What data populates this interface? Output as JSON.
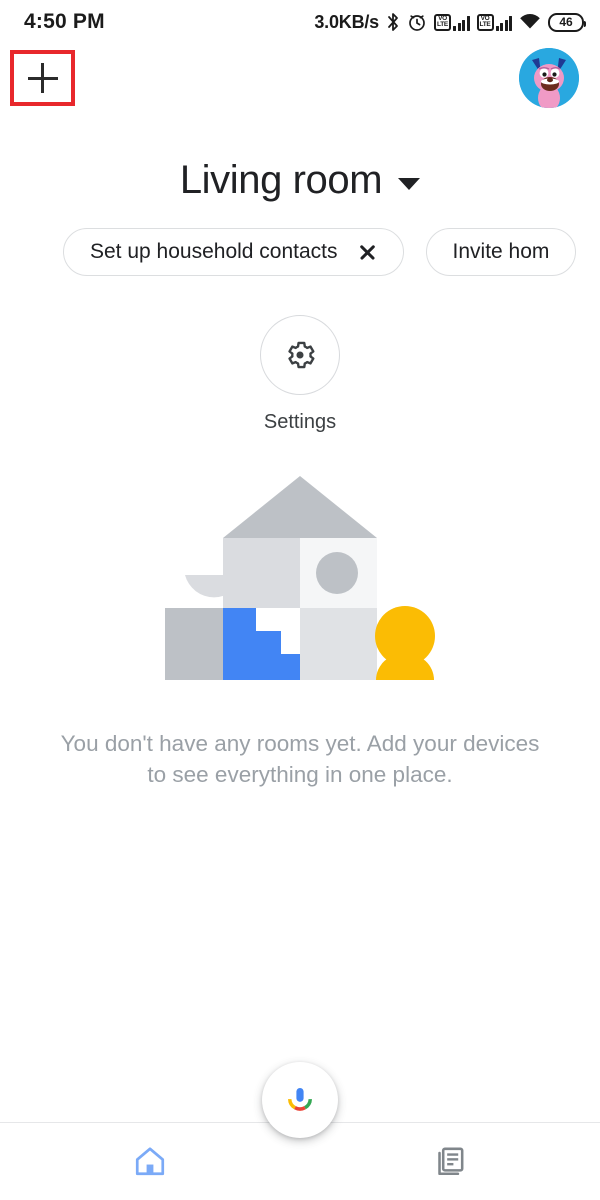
{
  "status_bar": {
    "time": "4:50 PM",
    "net_speed": "3.0KB/s",
    "bluetooth_icon": "bluetooth-icon",
    "alarm_icon": "alarm-clock-icon",
    "volte_label_top": "VO",
    "volte_label_bottom": "LTE",
    "sim1_icon": "volte-sim1-signal-icon",
    "sim2_icon": "volte-sim2-signal-icon",
    "wifi_icon": "wifi-icon",
    "battery_level": "46"
  },
  "top_bar": {
    "add_icon": "plus-icon",
    "add_label": "+",
    "avatar_icon": "account-avatar"
  },
  "home": {
    "title": "Living room",
    "caret_icon": "chevron-down-icon"
  },
  "chips": [
    {
      "label": "Set up household contacts",
      "close_icon": "close-icon",
      "dismissible": true
    },
    {
      "label": "Invite hom",
      "dismissible": false
    }
  ],
  "settings": {
    "icon": "gear-icon",
    "label": "Settings"
  },
  "empty_state": {
    "illustration": "house-rooms-illustration",
    "message": "You don't have any rooms yet. Add your devices to see everything in one place."
  },
  "assistant_fab": {
    "icon": "google-assistant-mic-icon"
  },
  "bottom_nav": [
    {
      "name": "home",
      "icon": "home-icon",
      "active": true
    },
    {
      "name": "feed",
      "icon": "feed-icon",
      "active": false
    }
  ],
  "colors": {
    "highlight": "#e8282c",
    "accent_blue": "#4285f4",
    "accent_yellow": "#fbbc04",
    "nav_active": "#7baaf7",
    "nav_inactive": "#80868b",
    "muted_text": "#9aa0a6",
    "illustration_gray": "#bdc1c6",
    "illustration_light": "#e0e2e5"
  }
}
